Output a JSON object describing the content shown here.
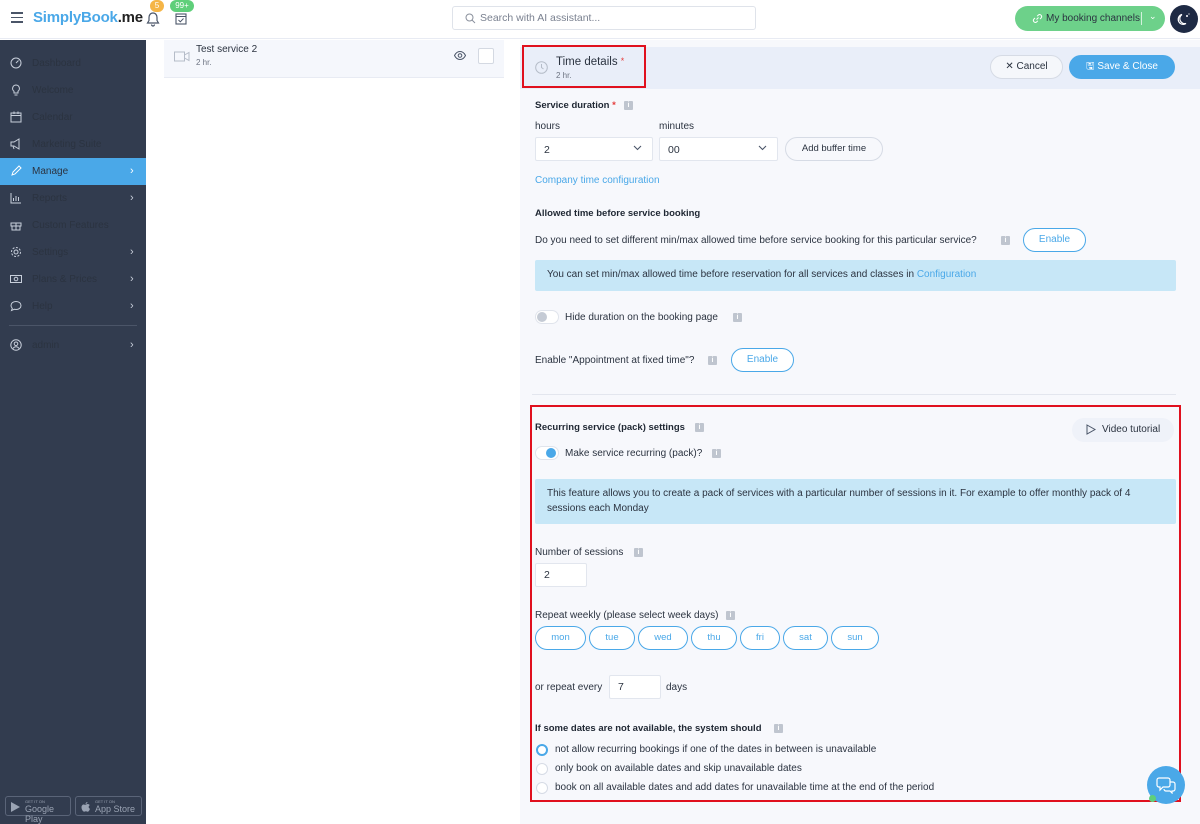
{
  "topbar": {
    "logo_brand": "SimplyBook",
    "logo_domain": ".me",
    "notifications_count": "5",
    "tasks_count": "99+",
    "search_placeholder": "Search with AI assistant...",
    "channels_label": "My booking channels"
  },
  "sidebar": {
    "items": [
      {
        "label": "Dashboard",
        "icon": "dashboard-icon",
        "arrow": false
      },
      {
        "label": "Welcome",
        "icon": "lightbulb-icon",
        "arrow": false
      },
      {
        "label": "Calendar",
        "icon": "calendar-icon",
        "arrow": false
      },
      {
        "label": "Marketing Suite",
        "icon": "megaphone-icon",
        "arrow": false
      },
      {
        "label": "Manage",
        "icon": "pencil-icon",
        "arrow": true,
        "active": true
      },
      {
        "label": "Reports",
        "icon": "chart-icon",
        "arrow": true
      },
      {
        "label": "Custom Features",
        "icon": "gift-icon",
        "arrow": false
      },
      {
        "label": "Settings",
        "icon": "gear-icon",
        "arrow": true
      },
      {
        "label": "Plans & Prices",
        "icon": "money-icon",
        "arrow": true
      },
      {
        "label": "Help",
        "icon": "chat-bubble-icon",
        "arrow": true
      }
    ],
    "user": {
      "label": "admin",
      "icon": "user-icon"
    },
    "stores": [
      {
        "small": "GET IT ON",
        "big": "Google Play"
      },
      {
        "small": "GET IT ON",
        "big": "App Store"
      }
    ]
  },
  "service_list": {
    "items": [
      {
        "name": "Test service 2",
        "duration": "2 hr."
      }
    ]
  },
  "detail": {
    "header": {
      "title": "Time details",
      "required_mark": "*",
      "subtitle": "2 hr.",
      "cancel_label": "Cancel",
      "save_label": "Save & Close"
    },
    "service_duration": {
      "label": "Service duration",
      "required_mark": "*",
      "hours_label": "hours",
      "hours_value": "2",
      "minutes_label": "minutes",
      "minutes_value": "00",
      "buffer_label": "Add buffer time",
      "company_link": "Company time configuration"
    },
    "allowed_time": {
      "title": "Allowed time before service booking",
      "question": "Do you need to set different min/max allowed time before service booking for this particular service?",
      "enable_label": "Enable",
      "info_text": "You can set min/max allowed time before reservation for all services and classes in",
      "info_link": "Configuration"
    },
    "hide_duration": {
      "label": "Hide duration on the booking page",
      "enabled": false
    },
    "fixed_time": {
      "label": "Enable \"Appointment at fixed time\"?",
      "enable_label": "Enable"
    },
    "recurring": {
      "title": "Recurring service (pack) settings",
      "video_label": "Video tutorial",
      "toggle_label": "Make service recurring (pack)?",
      "toggle_enabled": true,
      "info_text": "This feature allows you to create a pack of services with a particular number of sessions in it. For example to offer monthly pack of 4 sessions each Monday",
      "sessions_label": "Number of sessions",
      "sessions_value": "2",
      "repeat_label": "Repeat weekly (please select week days)",
      "days": [
        "mon",
        "tue",
        "wed",
        "thu",
        "fri",
        "sat",
        "sun"
      ],
      "repeat_every_label": "or repeat every",
      "repeat_every_value": "7",
      "days_label": "days",
      "unavailable_title": "If some dates are not available, the system should",
      "options": [
        {
          "label": "not allow recurring bookings if one of the dates in between is unavailable",
          "selected": true
        },
        {
          "label": "only book on available dates and skip unavailable dates",
          "selected": false
        },
        {
          "label": "book on all available dates and add dates for unavailable time at the end of the period",
          "selected": false
        }
      ]
    }
  },
  "colors": {
    "accent": "#4aa8e8",
    "sidebar_bg": "#323c4f",
    "channels_green": "#6dd18a",
    "highlight_red": "#e0101e",
    "info_bg": "#c7e7f7"
  }
}
